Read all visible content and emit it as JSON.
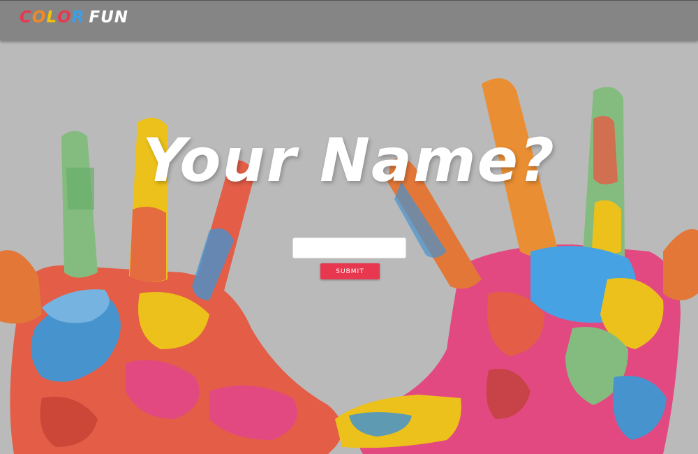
{
  "navbar": {
    "logo_letters": [
      {
        "char": "C",
        "color": "#e8384f"
      },
      {
        "char": "O",
        "color": "#f08a24"
      },
      {
        "char": "L",
        "color": "#f2c20a"
      },
      {
        "char": "O",
        "color": "#e8384f"
      },
      {
        "char": "R",
        "color": "#3aa0e8"
      }
    ],
    "logo_suffix": "FUN"
  },
  "hero": {
    "headline": "Your Name?",
    "image_icon": "painted-hands-image"
  },
  "form": {
    "name_value": "",
    "name_placeholder": "",
    "submit_label": "SUBMIT"
  },
  "colors": {
    "accent": "#e8384f",
    "navbar": "#858585",
    "background": "#b9b9b9"
  }
}
